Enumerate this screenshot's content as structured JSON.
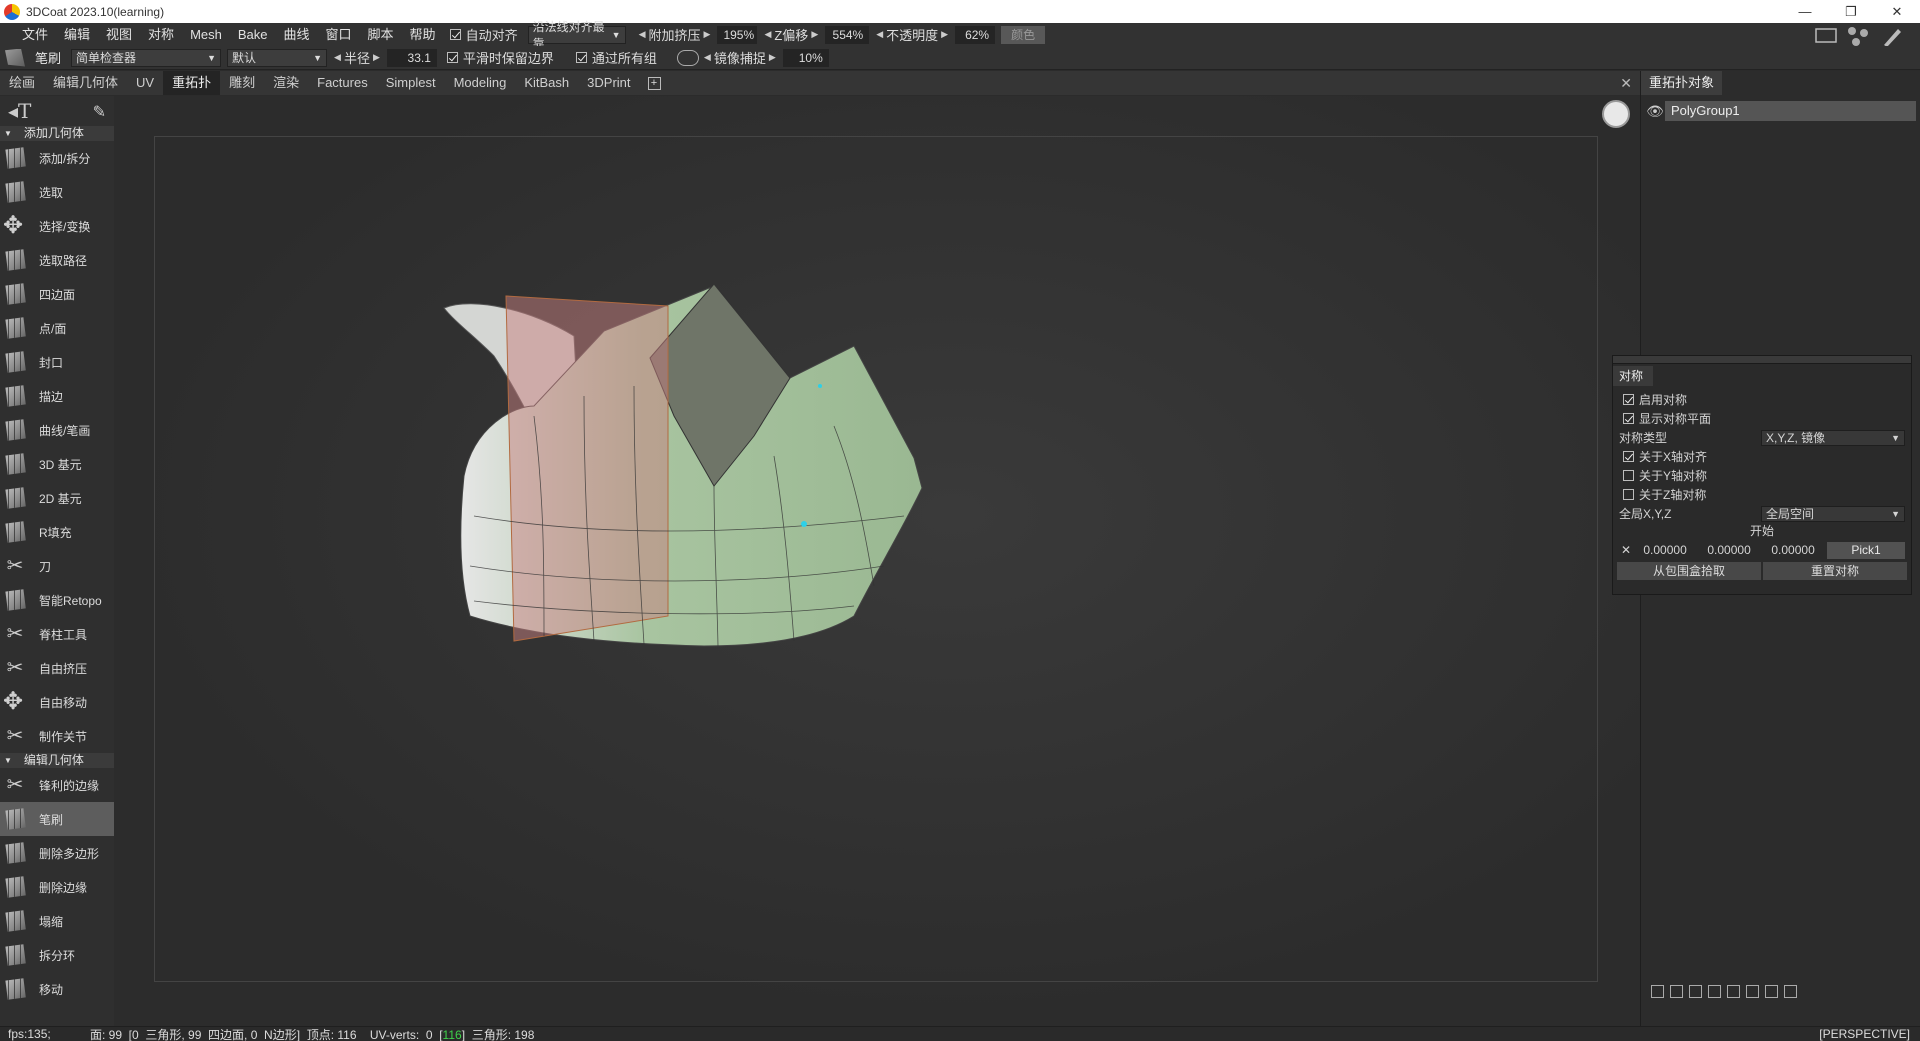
{
  "window": {
    "title": "3DCoat 2023.10(learning)",
    "minimize": "—",
    "restore": "❐",
    "close": "✕"
  },
  "menu": [
    "文件",
    "编辑",
    "视图",
    "对称",
    "Mesh",
    "Bake",
    "曲线",
    "窗口",
    "脚本",
    "帮助"
  ],
  "menu_options": {
    "auto_align": "自动对齐",
    "align_mode": "沿法线对齐最靠",
    "extra_extrude_label": "附加挤压",
    "extra_extrude_value": "195%",
    "z_offset_label": "Z偏移",
    "z_offset_value": "554%",
    "opacity_label": "不透明度",
    "opacity_value": "62%",
    "color_label": "颜色"
  },
  "toolbar": {
    "tool_name": "笔刷",
    "preset": "简单检查器",
    "mode": "默认",
    "radius_label": "半径",
    "radius_value": "33.1",
    "keep_border_label": "平滑时保留边界",
    "through_groups_label": "通过所有组",
    "mirror_snap_label": "镜像捕捉",
    "mirror_snap_value": "10%"
  },
  "tabs": [
    "绘画",
    "编辑几何体",
    "UV",
    "重拓扑",
    "雕刻",
    "渲染",
    "Factures",
    "Simplest",
    "Modeling",
    "KitBash",
    "3DPrint"
  ],
  "active_tab": "重拓扑",
  "left_panel": {
    "section1": "添加几何体",
    "tools1": [
      {
        "label": "添加/拆分",
        "icon": "cube"
      },
      {
        "label": "选取",
        "icon": "cube"
      },
      {
        "label": "选择/变换",
        "icon": "move"
      },
      {
        "label": "选取路径",
        "icon": "cube"
      },
      {
        "label": "四边面",
        "icon": "cube"
      },
      {
        "label": "点/面",
        "icon": "cube"
      },
      {
        "label": "封口",
        "icon": "cube"
      },
      {
        "label": "描边",
        "icon": "cube"
      },
      {
        "label": "曲线/笔画",
        "icon": "cube"
      },
      {
        "label": "3D 基元",
        "icon": "cube"
      },
      {
        "label": "2D 基元",
        "icon": "cube"
      },
      {
        "label": "R填充",
        "icon": "cube"
      },
      {
        "label": "刀",
        "icon": "glyph"
      },
      {
        "label": "智能Retopo",
        "icon": "cube"
      },
      {
        "label": "脊柱工具",
        "icon": "glyph"
      },
      {
        "label": "自由挤压",
        "icon": "glyph"
      },
      {
        "label": "自由移动",
        "icon": "move"
      },
      {
        "label": "制作关节",
        "icon": "glyph"
      }
    ],
    "section2": "编辑几何体",
    "tools2": [
      {
        "label": "锋利的边缘",
        "icon": "glyph"
      },
      {
        "label": "笔刷",
        "icon": "cube",
        "active": true
      },
      {
        "label": "删除多边形",
        "icon": "cube"
      },
      {
        "label": "删除边缘",
        "icon": "cube"
      },
      {
        "label": "塌缩",
        "icon": "cube"
      },
      {
        "label": "拆分环",
        "icon": "cube"
      },
      {
        "label": "移动",
        "icon": "cube"
      }
    ]
  },
  "right_panel": {
    "title": "重拓扑对象",
    "object": "PolyGroup1"
  },
  "symmetry": {
    "title": "对称",
    "enable": "启用对称",
    "show_plane": "显示对称平面",
    "type_label": "对称类型",
    "type_value": "X,Y,Z, 镜像",
    "about_x": "关于X轴对齐",
    "about_y": "关于Y轴对称",
    "about_z": "关于Z轴对称",
    "space_label": "全局X,Y,Z",
    "space_value": "全局空间",
    "start": "开始",
    "x": "0.00000",
    "y": "0.00000",
    "z": "0.00000",
    "pick": "Pick1",
    "from_bbox": "从包围盒拾取",
    "reset": "重置对称"
  },
  "status": {
    "fps": "fps:135;",
    "stats_prefix": "面: 99  [0  三角形, 99  四边面, 0  N边形]  顶点: 116    UV-verts:  0  [",
    "uv_count": "116",
    "stats_suffix": "]  三角形: 198",
    "view": "[PERSPECTIVE]"
  }
}
